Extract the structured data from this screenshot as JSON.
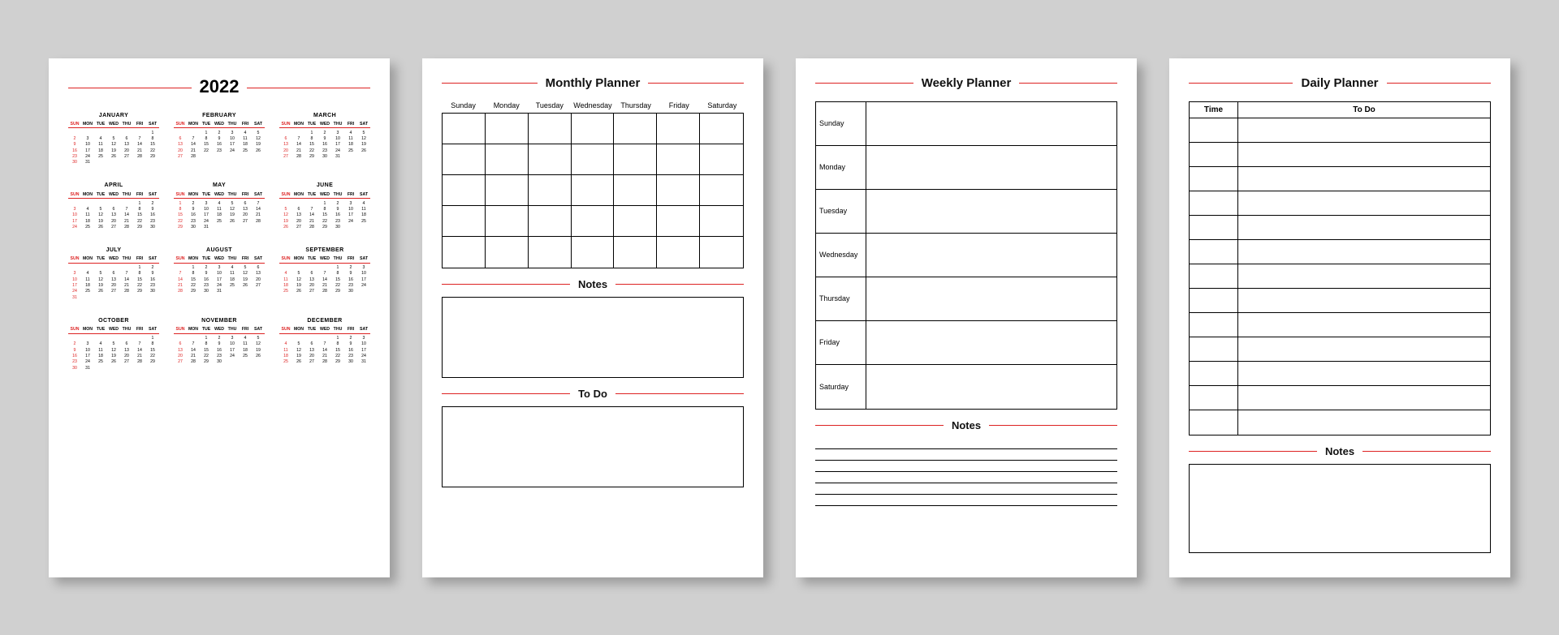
{
  "year": "2022",
  "dow_short": [
    "SUN",
    "MON",
    "TUE",
    "WED",
    "THU",
    "FRI",
    "SAT"
  ],
  "dow_long": [
    "Sunday",
    "Monday",
    "Tuesday",
    "Wednesday",
    "Thursday",
    "Friday",
    "Saturday"
  ],
  "months": [
    {
      "name": "JANUARY",
      "start": 6,
      "days": 31
    },
    {
      "name": "FEBRUARY",
      "start": 2,
      "days": 28
    },
    {
      "name": "MARCH",
      "start": 2,
      "days": 31
    },
    {
      "name": "APRIL",
      "start": 5,
      "days": 30
    },
    {
      "name": "MAY",
      "start": 0,
      "days": 31
    },
    {
      "name": "JUNE",
      "start": 3,
      "days": 30
    },
    {
      "name": "JULY",
      "start": 5,
      "days": 31
    },
    {
      "name": "AUGUST",
      "start": 1,
      "days": 31
    },
    {
      "name": "SEPTEMBER",
      "start": 4,
      "days": 30
    },
    {
      "name": "OCTOBER",
      "start": 6,
      "days": 31
    },
    {
      "name": "NOVEMBER",
      "start": 2,
      "days": 30
    },
    {
      "name": "DECEMBER",
      "start": 4,
      "days": 31
    }
  ],
  "titles": {
    "monthly": "Monthly Planner",
    "weekly": "Weekly Planner",
    "daily": "Daily Planner",
    "notes": "Notes",
    "todo": "To Do",
    "time": "Time"
  },
  "monthly_grid": {
    "rows": 5,
    "cols": 7
  },
  "weekly_days": [
    "Sunday",
    "Monday",
    "Tuesday",
    "Wednesday",
    "Thursday",
    "Friday",
    "Saturday"
  ],
  "weekly_notes_lines": 6,
  "daily_rows": 13
}
